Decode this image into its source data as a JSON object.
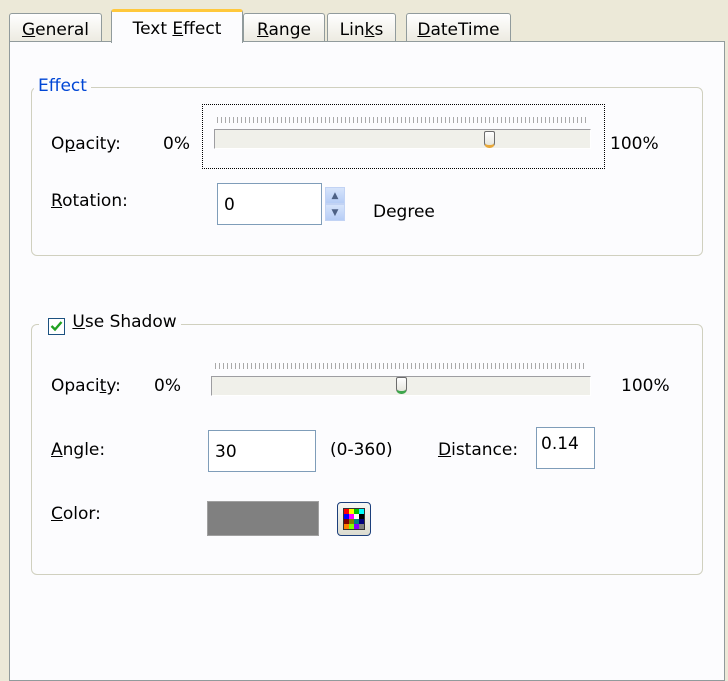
{
  "tabs": [
    {
      "label_u": "G",
      "label_rest": "eneral"
    },
    {
      "label_pre": "Text ",
      "label_u": "E",
      "label_rest": "ffect"
    },
    {
      "label_u": "R",
      "label_rest": "ange"
    },
    {
      "label_pre": "Lin",
      "label_u": "k",
      "label_rest": "s"
    },
    {
      "label_u": "D",
      "label_rest": "ateTime"
    }
  ],
  "effect": {
    "legend": "Effect",
    "opacity_label_pre": "O",
    "opacity_label_u": "p",
    "opacity_label_rest": "acity:",
    "min_label": "0%",
    "max_label": "100%",
    "opacity_value_percent": 73,
    "rotation_label_u": "R",
    "rotation_label_rest": "otation:",
    "rotation_value": "0",
    "rotation_unit": "Degree"
  },
  "shadow": {
    "checkbox_label_u": "U",
    "checkbox_label_rest": "se Shadow",
    "checked": true,
    "opacity_label_pre": "Opaci",
    "opacity_label_u": "t",
    "opacity_label_rest": "y:",
    "min_label": "0%",
    "max_label": "100%",
    "opacity_value_percent": 50,
    "angle_label_u": "A",
    "angle_label_rest": "ngle:",
    "angle_value": "30",
    "angle_range": "(0-360)",
    "distance_label_u": "D",
    "distance_label_rest": "istance:",
    "distance_value": "0.14",
    "color_label_u": "C",
    "color_label_rest": "olor:",
    "color_value": "#808080"
  },
  "colors": {
    "group_legend": "#0046d5",
    "checkmark": "#21a121"
  }
}
